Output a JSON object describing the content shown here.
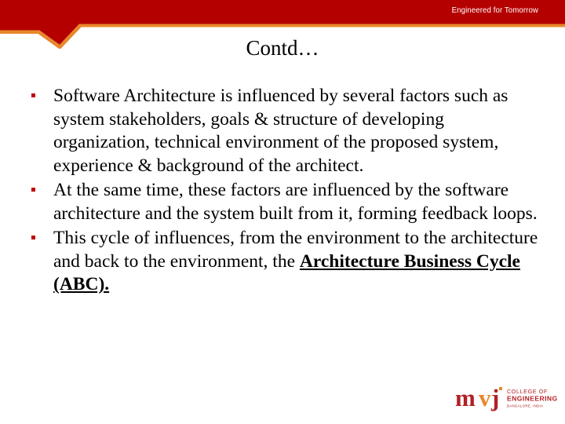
{
  "slide": {
    "title": "Contd…",
    "header": {
      "tagline": "Engineered for Tomorrow",
      "band_color": "#b50000",
      "accent_color": "#e8872a"
    },
    "bullet_color": "#c00000",
    "body_text_color": "#000000",
    "bullets": [
      {
        "text_parts": [
          {
            "text": "Software Architecture is influenced by several factors such as system stakeholders, goals & structure of developing organization, technical environment of the proposed system, experience & background of the architect.",
            "style": "normal"
          }
        ]
      },
      {
        "text_parts": [
          {
            "text": "At the same time, these factors are influenced by the software architecture and the system built from it, forming feedback loops.",
            "style": "normal"
          }
        ]
      },
      {
        "text_parts": [
          {
            "text": "This cycle of influences, from the environment to the architecture and back to the environment, the ",
            "style": "normal"
          },
          {
            "text": "Architecture Business Cycle (ABC).",
            "style": "bold-underline"
          }
        ]
      }
    ]
  },
  "logo": {
    "wordmark": "mvj",
    "line1": "COLLEGE OF",
    "line2": "ENGINEERING",
    "line3": "BANGALORE, INDIA",
    "color_m": "#b12026",
    "color_v": "#e8872a",
    "color_j": "#b12026",
    "color_text": "#b12026",
    "color_dot": "#e8872a"
  }
}
